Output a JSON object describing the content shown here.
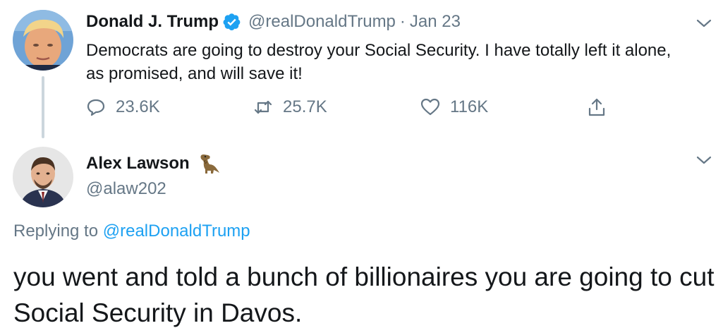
{
  "original_tweet": {
    "display_name": "Donald J. Trump",
    "handle": "@realDonaldTrump",
    "separator": "·",
    "date": "Jan 23",
    "text": "Democrats are going to destroy your Social Security. I have totally left it alone, as promised, and will save it!",
    "replies": "23.6K",
    "retweets": "25.7K",
    "likes": "116K",
    "verified": true
  },
  "reply_tweet": {
    "display_name": "Alex Lawson",
    "handle": "@alaw202",
    "emoji": "dinosaur-emoji",
    "replying_prefix": "Replying to",
    "replying_to": "@realDonaldTrump",
    "text": "you went and told a bunch of billionaires you are going to cut Social Security in Davos."
  },
  "colors": {
    "text": "#14171a",
    "secondary": "#657786",
    "accent": "#1da1f2",
    "thread_line": "#ccd6dd"
  }
}
